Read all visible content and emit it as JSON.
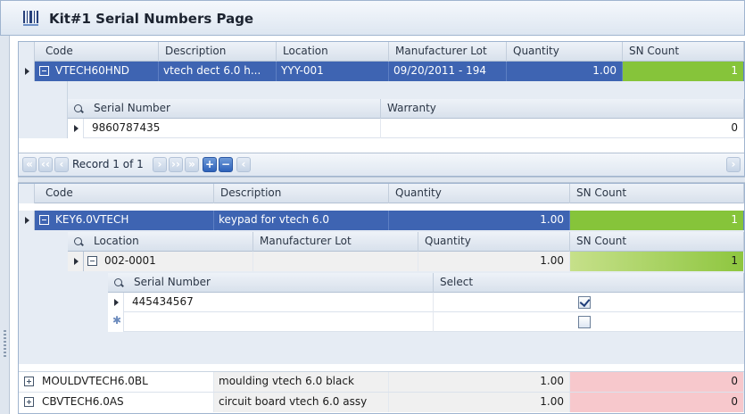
{
  "window": {
    "title": "Kit#1 Serial Numbers Page",
    "icon": "barcode-icon"
  },
  "top_grid": {
    "columns": [
      "Code",
      "Description",
      "Location",
      "Manufacturer Lot",
      "Quantity",
      "SN Count"
    ],
    "row": {
      "code": "VTECH60HND",
      "description": "vtech dect 6.0 h...",
      "location": "YYY-001",
      "lot": "09/20/2011 - 194",
      "quantity": "1.00",
      "sn_count": "1"
    },
    "detail": {
      "columns": [
        "Serial Number",
        "Warranty"
      ],
      "row": {
        "serial": "9860787435",
        "warranty": "0"
      }
    },
    "navigator": {
      "record_text": "Record 1 of 1"
    }
  },
  "bottom_grid": {
    "columns": [
      "Code",
      "Description",
      "Quantity",
      "SN Count"
    ],
    "rows": [
      {
        "code": "KEY6.0VTECH",
        "description": "keypad for vtech 6.0",
        "quantity": "1.00",
        "sn_count": "1"
      },
      {
        "code": "MOULDVTECH6.0BL",
        "description": "moulding vtech 6.0 black",
        "quantity": "1.00",
        "sn_count": "0"
      },
      {
        "code": "CBVTECH6.0AS",
        "description": "circuit board vtech 6.0 assy",
        "quantity": "1.00",
        "sn_count": "0"
      }
    ],
    "location_detail": {
      "columns": [
        "Location",
        "Manufacturer Lot",
        "Quantity",
        "SN Count"
      ],
      "row": {
        "location": "002-0001",
        "quantity": "1.00",
        "sn_count": "1"
      },
      "serial_detail": {
        "columns": [
          "Serial Number",
          "Select"
        ],
        "row": {
          "serial": "445434567",
          "selected": true
        }
      }
    }
  },
  "colors": {
    "selected_row": "#3e64b2",
    "sn_ok": "#86c43a",
    "sn_missing": "#f7c8cc"
  }
}
